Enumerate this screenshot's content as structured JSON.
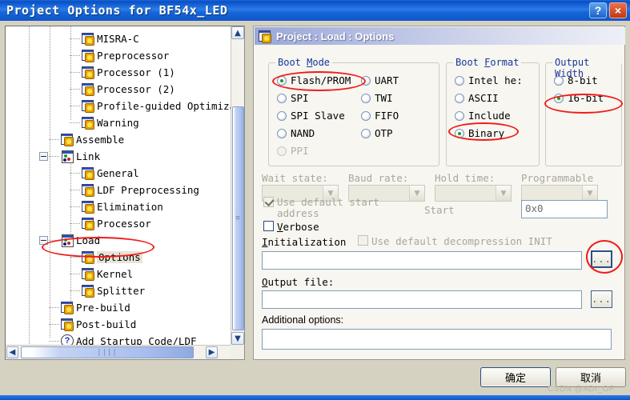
{
  "window": {
    "title": "Project Options for BF54x_LED",
    "help_button": "?",
    "close_button": "×"
  },
  "tree": {
    "items": [
      {
        "label": "MISRA-C",
        "icon": "module-icon",
        "indent": 3,
        "selected": false
      },
      {
        "label": "Preprocessor",
        "icon": "module-icon",
        "indent": 3,
        "selected": false
      },
      {
        "label": "Processor (1)",
        "icon": "module-icon",
        "indent": 3,
        "selected": false
      },
      {
        "label": "Processor (2)",
        "icon": "module-icon",
        "indent": 3,
        "selected": false
      },
      {
        "label": "Profile-guided Optimiza",
        "icon": "module-icon",
        "indent": 3,
        "selected": false
      },
      {
        "label": "Warning",
        "icon": "module-icon",
        "indent": 3,
        "selected": false
      },
      {
        "label": "Assemble",
        "icon": "module-icon",
        "indent": 2,
        "selected": false
      },
      {
        "label": "Link",
        "icon": "group-icon",
        "indent": 2,
        "selected": false,
        "expander": "minus"
      },
      {
        "label": "General",
        "icon": "module-icon",
        "indent": 3,
        "selected": false
      },
      {
        "label": "LDF Preprocessing",
        "icon": "module-icon",
        "indent": 3,
        "selected": false
      },
      {
        "label": "Elimination",
        "icon": "module-icon",
        "indent": 3,
        "selected": false
      },
      {
        "label": "Processor",
        "icon": "module-icon",
        "indent": 3,
        "selected": false
      },
      {
        "label": "Load",
        "icon": "group-icon",
        "indent": 2,
        "selected": false,
        "expander": "minus"
      },
      {
        "label": "Options",
        "icon": "module-icon",
        "indent": 3,
        "selected": true
      },
      {
        "label": "Kernel",
        "icon": "module-icon",
        "indent": 3,
        "selected": false
      },
      {
        "label": "Splitter",
        "icon": "module-icon",
        "indent": 3,
        "selected": false
      },
      {
        "label": "Pre-build",
        "icon": "module-icon",
        "indent": 2,
        "selected": false
      },
      {
        "label": "Post-build",
        "icon": "module-icon",
        "indent": 2,
        "selected": false
      },
      {
        "label": "Add Startup Code/LDF",
        "icon": "help-icon",
        "indent": 2,
        "selected": false
      }
    ],
    "scroll_up": "▲",
    "scroll_down": "▼",
    "scroll_left": "◀",
    "scroll_right": "▶",
    "grip": "||||"
  },
  "panel": {
    "header": "Project : Load : Options",
    "boot_mode": {
      "legend": "Boot Mode",
      "legend_mnemonic": "M",
      "column1": [
        {
          "label": "Flash/PROM",
          "selected": true,
          "disabled": false
        },
        {
          "label": "SPI",
          "selected": false,
          "disabled": false
        },
        {
          "label": "SPI Slave",
          "selected": false,
          "disabled": false
        },
        {
          "label": "NAND",
          "selected": false,
          "disabled": false
        },
        {
          "label": "PPI",
          "selected": false,
          "disabled": true
        }
      ],
      "column2": [
        {
          "label": "UART",
          "selected": false,
          "disabled": false
        },
        {
          "label": "TWI",
          "selected": false,
          "disabled": false
        },
        {
          "label": "FIFO",
          "selected": false,
          "disabled": false
        },
        {
          "label": "OTP",
          "selected": false,
          "disabled": false
        }
      ]
    },
    "boot_format": {
      "legend": "Boot Format",
      "legend_mnemonic": "F",
      "options": [
        {
          "label": "Intel he:",
          "selected": false,
          "disabled": false
        },
        {
          "label": "ASCII",
          "selected": false,
          "disabled": false
        },
        {
          "label": "Include",
          "selected": false,
          "disabled": false
        },
        {
          "label": "Binary",
          "selected": true,
          "disabled": false
        }
      ]
    },
    "output_width": {
      "legend": "Output Width",
      "legend_mnemonic": "W",
      "options": [
        {
          "label": "8-bit",
          "selected": false,
          "disabled": false
        },
        {
          "label": "16-bit",
          "selected": true,
          "disabled": false
        }
      ]
    },
    "combos": [
      {
        "label": "Wait state:",
        "value": "",
        "disabled": true
      },
      {
        "label": "Baud rate:",
        "value": "",
        "disabled": true
      },
      {
        "label": "Hold time:",
        "value": "",
        "disabled": true
      },
      {
        "label": "Programmable",
        "value": "",
        "disabled": true
      }
    ],
    "use_default_start": {
      "line1": "Use default start",
      "line2": "address",
      "checked": true,
      "disabled": true
    },
    "verbose": {
      "label": "Verbose",
      "checked": false,
      "disabled": false
    },
    "start_label": "Start",
    "start_value": "0x0",
    "initialization": {
      "label": "Initialization",
      "decompression_label": "Use default decompression INIT",
      "decompression_checked": false,
      "decompression_disabled": true,
      "value": "",
      "browse_button": "..."
    },
    "output_file": {
      "label": "Output file:",
      "value": "",
      "browse_button": "..."
    },
    "additional_options": {
      "label": "Additional options:",
      "value": ""
    }
  },
  "footer": {
    "ok_button": "确定",
    "cancel_button": "取消",
    "watermark": "CSDN @ADI_OP"
  },
  "colors": {
    "title_blue": "#1666d8",
    "legend_blue": "#16369c",
    "annotation_red": "#f01c1c",
    "selection_beige": "#e8e4d8",
    "panel_bg": "#f7f6f0"
  }
}
